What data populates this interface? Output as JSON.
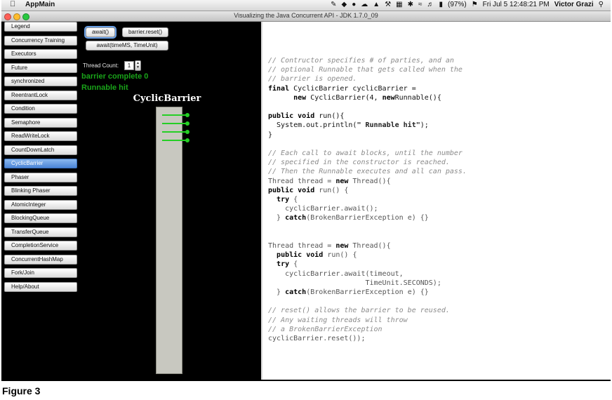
{
  "menubar": {
    "app_name": "AppMain",
    "battery": "(97%)",
    "clock": "Fri Jul 5  12:48:21 PM",
    "user": "Victor Grazi",
    "status_icons": [
      "pen-icon",
      "dropbox-icon",
      "camera-icon",
      "cloud-icon",
      "drive-icon",
      "5",
      "tools-icon",
      "grid-icon",
      "drop-icon",
      "pin-icon",
      "timemachine-icon",
      "display-icon",
      "bluetooth-icon",
      "wifi-icon",
      "volume-icon",
      "battery-icon",
      "flag-icon",
      "search-icon"
    ]
  },
  "window": {
    "title": "Visualizing the Java Concurrent API - JDK 1.7.0_09"
  },
  "sidebar": {
    "items": [
      {
        "label": "Legend"
      },
      {
        "label": "Concurrency Training"
      },
      {
        "label": "Executors"
      },
      {
        "label": "Future"
      },
      {
        "label": "synchronized"
      },
      {
        "label": "ReentrantLock"
      },
      {
        "label": "Condition"
      },
      {
        "label": "Semaphore"
      },
      {
        "label": "ReadWriteLock"
      },
      {
        "label": "CountDownLatch"
      },
      {
        "label": "CyclicBarrier"
      },
      {
        "label": "Phaser"
      },
      {
        "label": "Blinking Phaser"
      },
      {
        "label": "AtomicInteger"
      },
      {
        "label": "BlockingQueue"
      },
      {
        "label": "TransferQueue"
      },
      {
        "label": "CompletionService"
      },
      {
        "label": "ConcurrentHashMap"
      },
      {
        "label": "Fork/Join"
      },
      {
        "label": "Help/About"
      }
    ],
    "active_index": 10
  },
  "controls": {
    "await_label": "await()",
    "reset_label": "barrier.reset()",
    "await_timeout_label": "await(timeMS, TimeUnit)",
    "thread_count_label": "Thread Count:",
    "thread_count_value": "1",
    "stepper_up": "▲",
    "stepper_down": "▼"
  },
  "status": {
    "line1": "barrier complete 0",
    "line2": "Runnable hit"
  },
  "visual": {
    "title": "CyclicBarrier",
    "waiting_threads": 4,
    "thread_color": "#25cf25",
    "barrier_color": "#c8c8c0"
  },
  "code": {
    "c1": "// Contructor specifies # of parties, and an",
    "c2": "// optional Runnable that gets called when the",
    "c3": "// barrier is opened.",
    "kw_final": "final",
    "l4_rest": " CyclicBarrier cyclicBarrier =",
    "l5_indent": "      ",
    "kw_new1": "new",
    "l5_mid": " CyclicBarrier(4, ",
    "kw_new2": "new",
    "l5_rest": "Runnable(){",
    "kw_public1": "public",
    "kw_void1": "void",
    "l7_rest": " run(){",
    "l8_a": "  System.out.println(",
    "l8_str": "\" Runnable hit\"",
    "l8_b": ");",
    "l9": "}",
    "c4": "// Each call to await blocks, until the number",
    "c5": "// specified in the constructor is reached.",
    "c6": "// Then the Runnable executes and all can pass.",
    "l13_a": "Thread thread = ",
    "kw_new3": "new",
    "l13_b": " Thread(){",
    "kw_public2": "public",
    "kw_void2": "void",
    "l14_rest": " run() {",
    "l15_indent": "  ",
    "kw_try1": "try",
    "l15_rest": " {",
    "l16": "    cyclicBarrier.await();",
    "l17_indent": "  } ",
    "kw_catch1": "catch",
    "l17_rest": "(BrokenBarrierException e) {}",
    "l20_a": "Thread thread = ",
    "kw_new4": "new",
    "l20_b": " Thread(){",
    "l21_indent": "  ",
    "kw_public3": "public",
    "kw_void3": "void",
    "l21_rest": " run() {",
    "l22_indent": "  ",
    "kw_try2": "try",
    "l22_rest": " {",
    "l23": "    cyclicBarrier.await(timeout,",
    "l24": "                       TimeUnit.SECONDS);",
    "l25_indent": "  } ",
    "kw_catch2": "catch",
    "l25_rest": "(BrokenBarrierException e) {}",
    "c7": "// reset() allows the barrier to be reused.",
    "c8": "// Any waiting threads will throw",
    "c9": "// a BrokenBarrierException",
    "l30": "cyclicBarrier.reset());"
  },
  "caption": "Figure 3"
}
